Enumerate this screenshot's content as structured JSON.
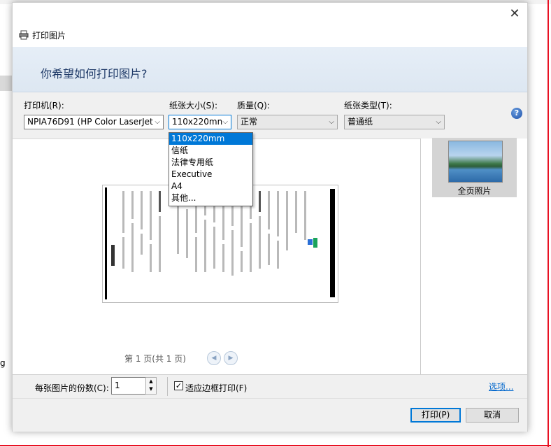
{
  "window": {
    "title": "打印图片",
    "close_glyph": "✕"
  },
  "background": {
    "left_text": "g"
  },
  "banner": {
    "heading": "你希望如何打印图片?"
  },
  "printer": {
    "label": "打印机(R):",
    "value": "NPIA76D91 (HP Color LaserJet"
  },
  "paper_size": {
    "label": "纸张大小(S):",
    "value": "110x220mn",
    "options": [
      "110x220mm",
      "信纸",
      "法律专用纸",
      "Executive",
      "A4",
      "其他..."
    ]
  },
  "quality": {
    "label": "质量(Q):",
    "value": "正常"
  },
  "paper_type": {
    "label": "纸张类型(T):",
    "value": "普通纸"
  },
  "help_glyph": "?",
  "layout": {
    "selected_label": "全页照片"
  },
  "pager": {
    "text": "第 1 页(共 1 页)",
    "prev_glyph": "◀",
    "next_glyph": "▶"
  },
  "copies": {
    "label": "每张图片的份数(C):",
    "value": "1"
  },
  "fit": {
    "checked": true,
    "check_glyph": "✓",
    "label": "适应边框打印(F)"
  },
  "options_link": "选项...",
  "buttons": {
    "print": "打印(P)",
    "cancel": "取消"
  },
  "colors": {
    "accent": "#0078d7",
    "banner_text": "#1f3a68",
    "link": "#0066cc"
  }
}
